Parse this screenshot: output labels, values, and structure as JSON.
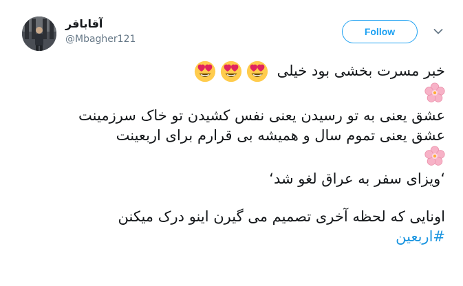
{
  "header": {
    "display_name": "آقاباقر",
    "handle": "@Mbagher121",
    "follow_label": "Follow"
  },
  "tweet": {
    "line1": "خبر مسرت بخشی بود خیلی",
    "line2": "عشق یعنی به تو رسیدن یعنی نفس کشیدن تو خاک سرزمینت",
    "line3": "عشق یعنی تموم سال و همیشه بی قرارم برای اربعینت",
    "line4": "‘ویزای سفر به عراق لغو شد‘",
    "line5": "اونایی که لحظه آخری تصمیم می گیرن اینو درک میکنن",
    "hashtag": "#اربعین",
    "emojis": [
      "heart-eyes-emoji",
      "heart-eyes-emoji",
      "heart-eyes-emoji"
    ]
  },
  "colors": {
    "accent": "#1da1f2",
    "hashtag": "#1b95e0",
    "text": "#14171a",
    "secondary": "#657786",
    "emoji_face": "#ffcc4d",
    "emoji_heart": "#e0245e",
    "blossom": "#f7b2c7"
  }
}
